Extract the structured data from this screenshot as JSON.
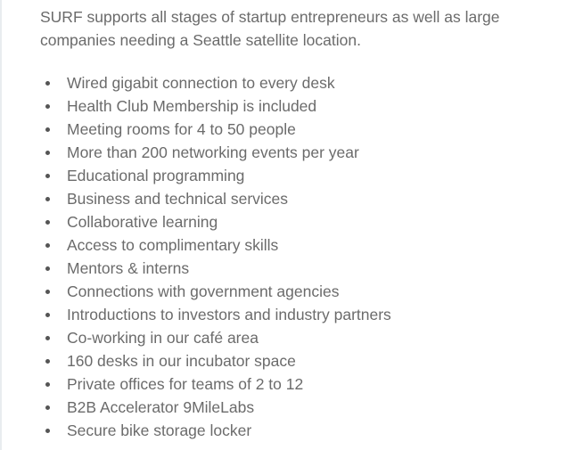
{
  "intro": "SURF supports all stages of startup entrepreneurs as well as large companies needing a Seattle satellite location.",
  "features": [
    "Wired gigabit connection to every desk",
    "Health Club Membership is included",
    "Meeting rooms for 4 to 50 people",
    "More than 200 networking events per year",
    "Educational programming",
    "Business and technical services",
    "Collaborative learning",
    "Access to complimentary skills",
    "Mentors & interns",
    "Connections with government agencies",
    "Introductions to investors and industry partners",
    "Co-working in our café area",
    "160 desks in our incubator space",
    "Private offices for teams of 2 to 12",
    "B2B Accelerator 9MileLabs",
    "Secure bike storage locker"
  ],
  "colors": {
    "text": "#6b6b6b",
    "bullet": "#555555",
    "background": "#ffffff"
  }
}
